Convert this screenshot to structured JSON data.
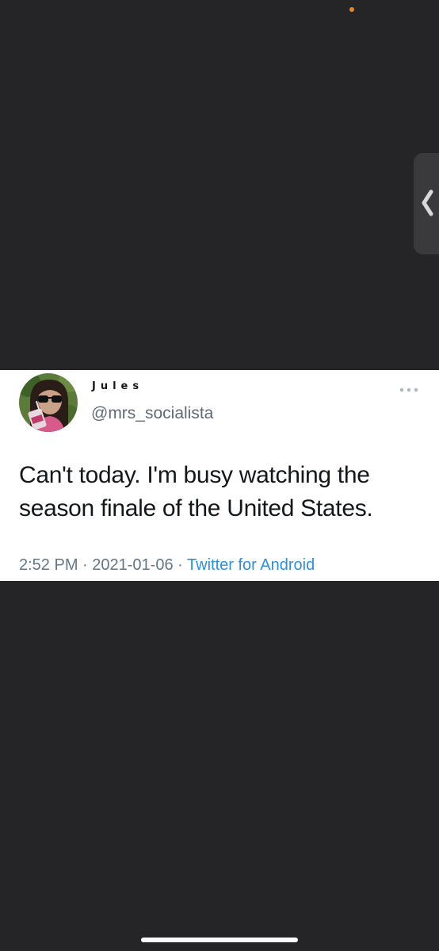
{
  "status": {
    "indicator_color": "#e08a2c"
  },
  "side_handle": {
    "icon": "chevron-left-icon"
  },
  "tweet": {
    "display_name": "Jules",
    "handle": "@mrs_socialista",
    "text": "Can't today. I'm busy watching the season finale of the United States.",
    "time": "2:52 PM",
    "separator": "·",
    "date": "2021-01-06",
    "source": "Twitter for Android",
    "more_icon": "more-horizontal-icon",
    "colors": {
      "text": "#14171a",
      "secondary": "#657786",
      "link": "#2f8fd8"
    }
  }
}
